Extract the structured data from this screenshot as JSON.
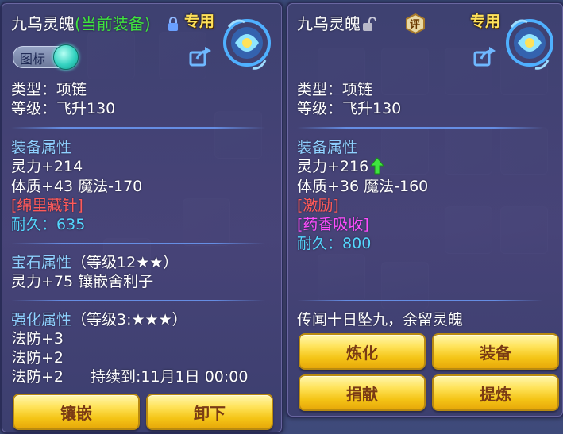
{
  "colors": {
    "accent_gold": "#ffe25a",
    "green": "#3fe43f",
    "cyan": "#55d8ff",
    "red": "#ff5a5a",
    "magenta": "#ff4dff",
    "section": "#8fd0ff"
  },
  "left_panel": {
    "name": "九乌灵魄",
    "equipped_tag": "(当前装备)",
    "lock_icon": "lock-icon",
    "exclusive": "专用",
    "toggle_label": "图标",
    "type": "类型：项链",
    "level": "等级：飞升130",
    "attr_title": "装备属性",
    "attr_line1": "灵力+214",
    "attr_line2": "体质+43 魔法-170",
    "special_skill": "[绵里藏针]",
    "durability_label": "耐久：",
    "durability_value": "635",
    "gem_title": "宝石属性",
    "gem_level": "（等级12★★）",
    "gem_line": "灵力+75 镶嵌舍利子",
    "enhance_title": "强化属性",
    "enhance_level": "（等级3:★★★）",
    "enhance_1": "法防+3",
    "enhance_2": "法防+2",
    "enhance_3": "法防+2",
    "enhance_duration": "持续到:11月1日 00:00",
    "buttons": [
      "镶嵌",
      "卸下"
    ]
  },
  "right_panel": {
    "name": "九乌灵魄",
    "unlock_icon": "unlock-icon",
    "rate_badge": "评",
    "exclusive": "专用",
    "type": "类型：项链",
    "level": "等级：飞升130",
    "attr_title": "装备属性",
    "attr_line1": "灵力+216",
    "attr_line2": "体质+36 魔法-160",
    "special_1": "[激励]",
    "special_2": "[药香吸收]",
    "durability_label": "耐久：",
    "durability_value": "800",
    "description": "传闻十日坠九，余留灵魄",
    "buttons": [
      "炼化",
      "装备",
      "捐献",
      "提炼"
    ]
  }
}
